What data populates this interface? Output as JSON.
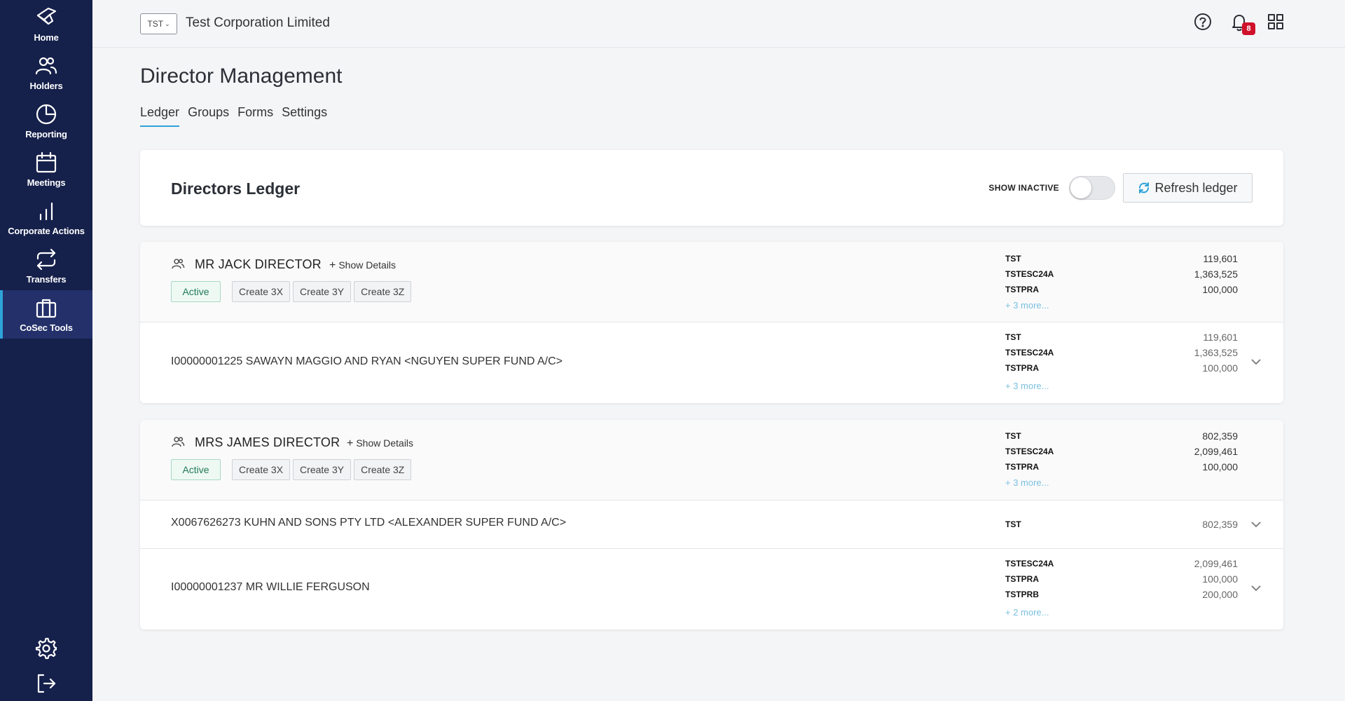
{
  "sidebar": {
    "items": [
      {
        "label": "Home",
        "icon": "home-icon"
      },
      {
        "label": "Holders",
        "icon": "users-icon"
      },
      {
        "label": "Reporting",
        "icon": "pie-chart-icon"
      },
      {
        "label": "Meetings",
        "icon": "calendar-icon"
      },
      {
        "label": "Corporate Actions",
        "icon": "bar-chart-icon"
      },
      {
        "label": "Transfers",
        "icon": "transfer-icon"
      },
      {
        "label": "CoSec Tools",
        "icon": "briefcase-icon"
      }
    ],
    "active": "CoSec Tools"
  },
  "header": {
    "company_code": "TST",
    "company_name": "Test Corporation Limited",
    "notification_count": "8"
  },
  "page": {
    "title": "Director Management",
    "tabs": [
      {
        "label": "Ledger",
        "active": true
      },
      {
        "label": "Groups"
      },
      {
        "label": "Forms"
      },
      {
        "label": "Settings"
      }
    ]
  },
  "ledger": {
    "title": "Directors Ledger",
    "show_inactive_label": "SHOW INACTIVE",
    "refresh_label": "Refresh ledger"
  },
  "directors": [
    {
      "name": "MR JACK DIRECTOR",
      "show_details": "Show Details",
      "status": "Active",
      "actions": [
        "Create 3X",
        "Create 3Y",
        "Create 3Z"
      ],
      "holdings": [
        {
          "code": "TST",
          "value": "119,601"
        },
        {
          "code": "TSTESC24A",
          "value": "1,363,525"
        },
        {
          "code": "TSTPRA",
          "value": "100,000"
        }
      ],
      "more": "+ 3 more...",
      "rows": [
        {
          "holder": "I00000001225 SAWAYN MAGGIO AND RYAN <NGUYEN SUPER FUND A/C>",
          "holdings": [
            {
              "code": "TST",
              "value": "119,601"
            },
            {
              "code": "TSTESC24A",
              "value": "1,363,525"
            },
            {
              "code": "TSTPRA",
              "value": "100,000"
            }
          ],
          "more": "+ 3 more..."
        }
      ]
    },
    {
      "name": "MRS JAMES DIRECTOR",
      "show_details": "Show Details",
      "status": "Active",
      "actions": [
        "Create 3X",
        "Create 3Y",
        "Create 3Z"
      ],
      "holdings": [
        {
          "code": "TST",
          "value": "802,359"
        },
        {
          "code": "TSTESC24A",
          "value": "2,099,461"
        },
        {
          "code": "TSTPRA",
          "value": "100,000"
        }
      ],
      "more": "+ 3 more...",
      "rows": [
        {
          "holder": "X0067626273 KUHN AND SONS PTY LTD <ALEXANDER SUPER FUND A/C>",
          "holdings": [
            {
              "code": "TST",
              "value": "802,359"
            }
          ],
          "more": ""
        },
        {
          "holder": "I00000001237 MR WILLIE FERGUSON",
          "holdings": [
            {
              "code": "TSTESC24A",
              "value": "2,099,461"
            },
            {
              "code": "TSTPRA",
              "value": "100,000"
            },
            {
              "code": "TSTPRB",
              "value": "200,000"
            }
          ],
          "more": "+ 2 more..."
        }
      ]
    }
  ]
}
